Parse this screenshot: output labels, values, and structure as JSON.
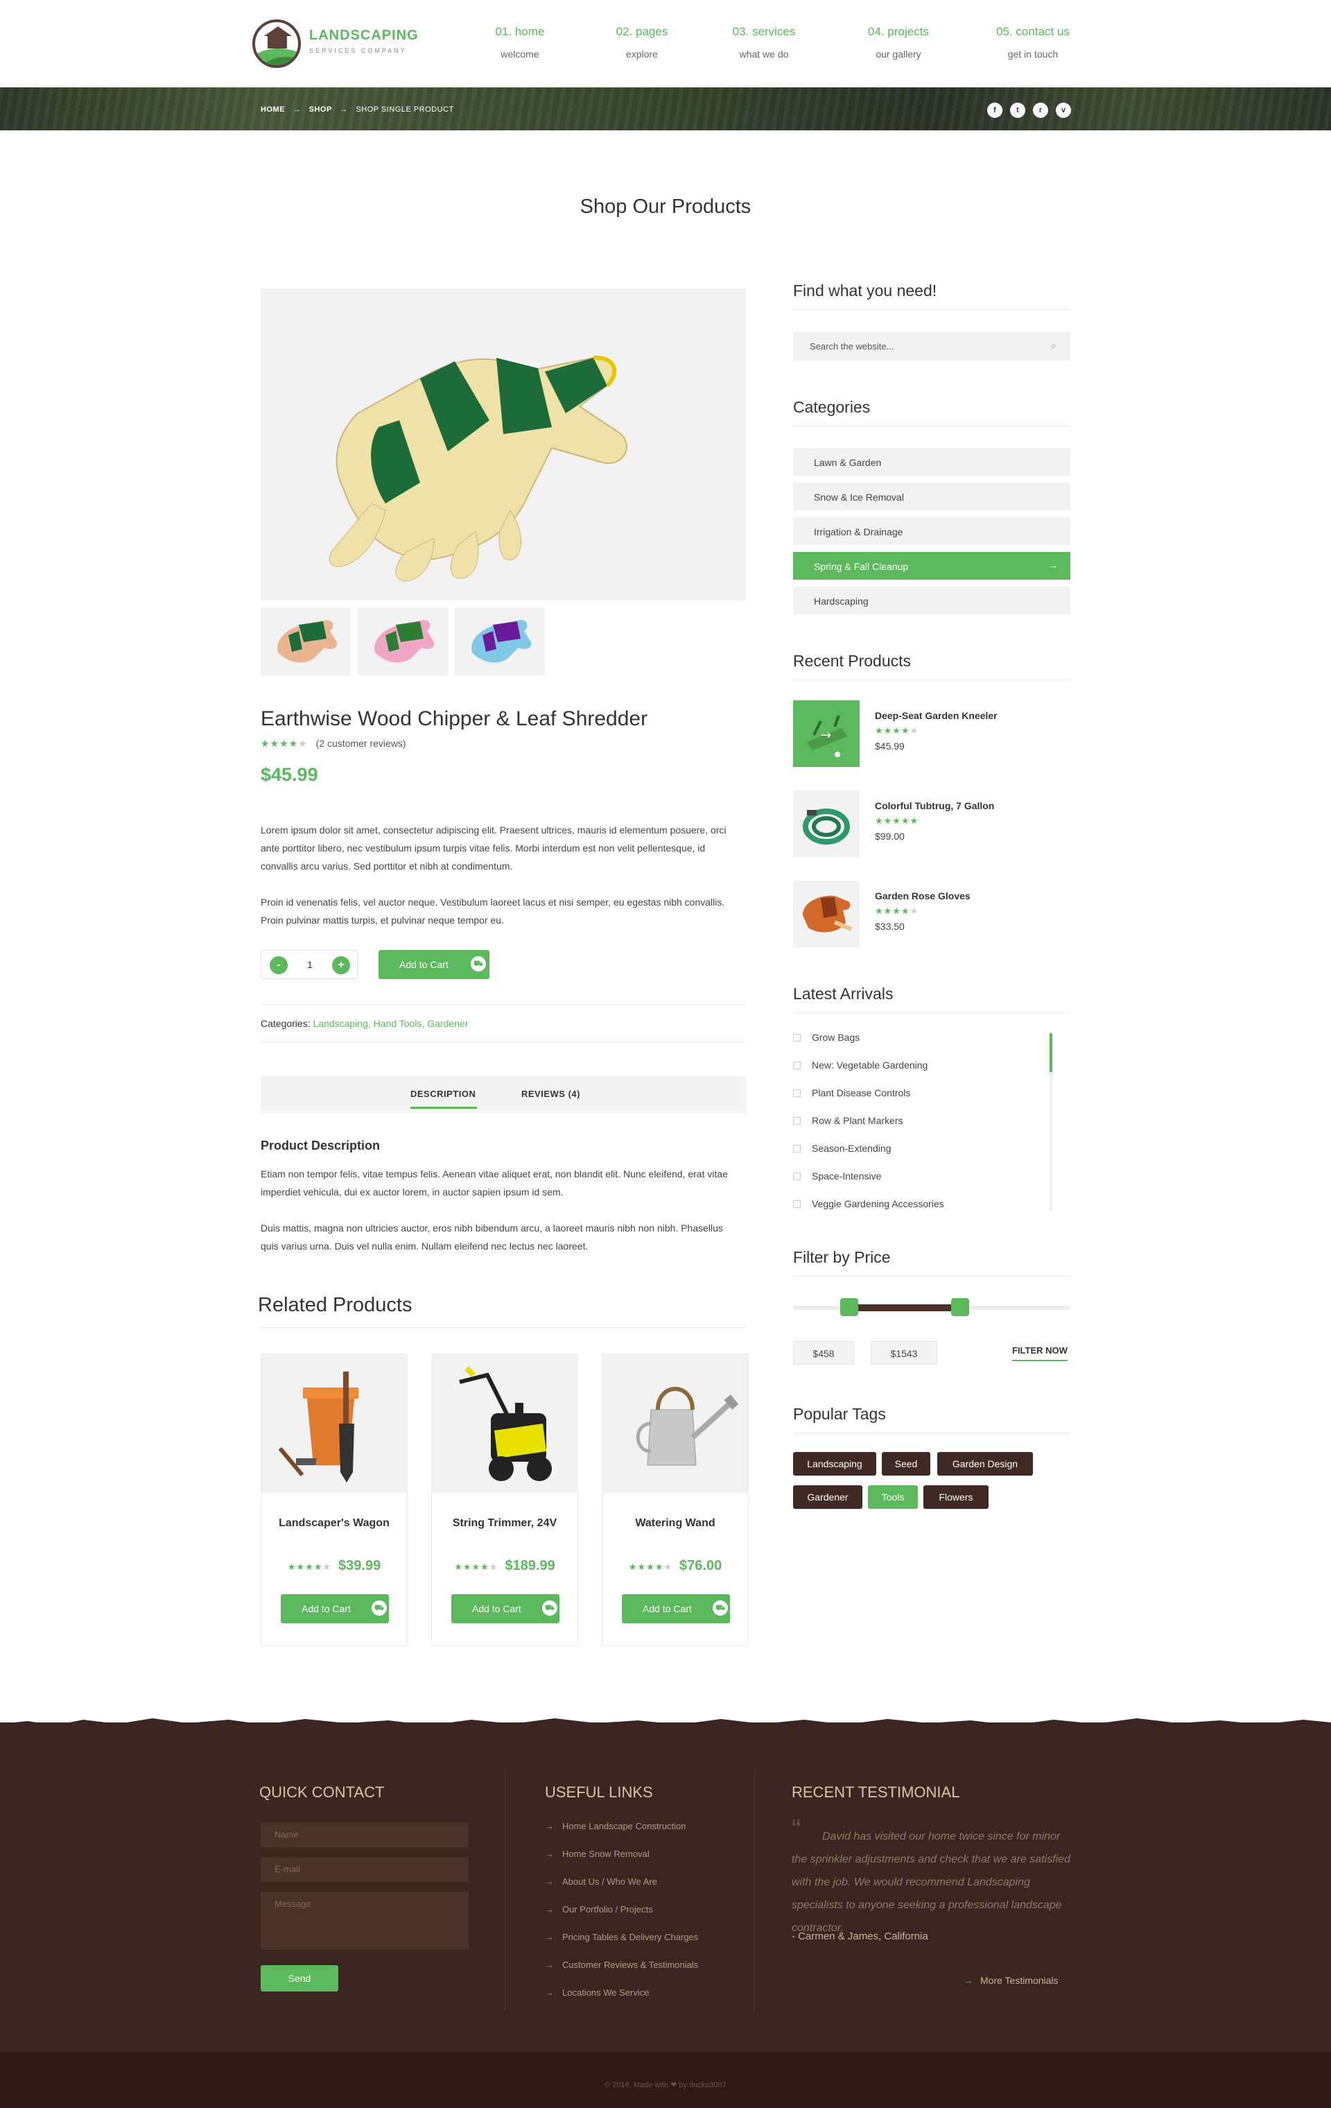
{
  "header": {
    "logo_title": "LANDSCAPING",
    "logo_subtitle": "SERVICES COMPANY",
    "nav": [
      {
        "title": "01. home",
        "sub": "welcome"
      },
      {
        "title": "02. pages",
        "sub": "explore"
      },
      {
        "title": "03. services",
        "sub": "what we do"
      },
      {
        "title": "04. projects",
        "sub": "our gallery"
      },
      {
        "title": "05. contact us",
        "sub": "get in touch"
      }
    ]
  },
  "breadcrumb": {
    "home": "HOME",
    "sep": "→",
    "shop": "SHOP",
    "current": "SHOP SINGLE PRODUCT"
  },
  "social": [
    {
      "icon": "facebook-icon",
      "glyph": "f"
    },
    {
      "icon": "twitter-icon",
      "glyph": "t"
    },
    {
      "icon": "rss-icon",
      "glyph": "r"
    },
    {
      "icon": "vimeo-icon",
      "glyph": "v"
    }
  ],
  "page_title": "Shop Our Products",
  "product": {
    "title": "Earthwise Wood Chipper & Leaf Shredder",
    "rating_stars": 4,
    "reviews": "(2 customer reviews)",
    "price": "$45.99",
    "desc1": "Lorem ipsum dolor sit amet, consectetur adipiscing elit. Praesent ultrices, mauris id elementum posuere, orci ante porttitor libero, nec vestibulum ipsum turpis vitae felis. Morbi interdum est non velit pellentesque, id convallis arcu varius. Sed porttitor et nibh at condimentum.",
    "desc2": "Proin id venenatis felis, vel auctor neque. Vestibulum laoreet lacus et nisi semper, eu egestas nibh convallis. Proin pulvinar mattis turpis, et pulvinar neque tempor eu.",
    "qty_minus": "-",
    "qty": "1",
    "qty_plus": "+",
    "add_to_cart": "Add to Cart",
    "categories_label": "Categories:",
    "categories": "Landscaping, Hand Tools, Gardener"
  },
  "tabs": {
    "description": "DESCRIPTION",
    "reviews": "REVIEWS (4)"
  },
  "description": {
    "heading": "Product Description",
    "p1": "Etiam non tempor felis, vitae tempus felis. Aenean vitae aliquet erat, non blandit elit. Nunc eleifend, erat vitae imperdiet vehicula, dui ex auctor lorem, in auctor sapien ipsum id sem.",
    "p2": "Duis mattis, magna non ultricies auctor, eros nibh bibendum arcu, a laoreet mauris nibh non nibh. Phasellus quis varius urna. Duis vel nulla enim. Nullam eleifend nec lectus nec laoreet."
  },
  "related": {
    "heading": "Related Products",
    "items": [
      {
        "name": "Landscaper's Wagon",
        "price": "$39.99",
        "stars": 4,
        "button": "Add to Cart"
      },
      {
        "name": "String Trimmer, 24V",
        "price": "$189.99",
        "stars": 4,
        "button": "Add to Cart"
      },
      {
        "name": "Watering Wand",
        "price": "$76.00",
        "stars": 4,
        "button": "Add to Cart"
      }
    ]
  },
  "sidebar": {
    "search_heading": "Find what you need!",
    "search_placeholder": "Search the website...",
    "categories_heading": "Categories",
    "categories": [
      "Lawn & Garden",
      "Snow & Ice Removal",
      "Irrigation & Drainage",
      "Spring & Fall Cleanup",
      "Hardscaping"
    ],
    "active_category": "Spring & Fall Cleanup",
    "recent_heading": "Recent Products",
    "recent": [
      {
        "name": "Deep-Seat Garden Kneeler",
        "stars": 4,
        "price": "$45.99"
      },
      {
        "name": "Colorful Tubtrug, 7 Gallon",
        "stars": 5,
        "price": "$99.00"
      },
      {
        "name": "Garden Rose Gloves",
        "stars": 4,
        "price": "$33.50"
      }
    ],
    "arrivals_heading": "Latest Arrivals",
    "arrivals": [
      "Grow Bags",
      "New: Vegetable Gardening",
      "Plant Disease Controls",
      "Row & Plant Markers",
      "Season-Extending",
      "Space-Intensive",
      "Veggie Gardening Accessories"
    ],
    "filter_heading": "Filter by Price",
    "price_min": "$458",
    "price_max": "$1543",
    "filter_button": "FILTER NOW",
    "tags_heading": "Popular Tags",
    "tags": [
      "Landscaping",
      "Seed",
      "Garden Design",
      "Gardener",
      "Tools",
      "Flowers"
    ],
    "active_tag": "Tools"
  },
  "footer": {
    "contact_heading": "QUICK CONTACT",
    "name_placeholder": "Name",
    "email_placeholder": "E-mail",
    "message_placeholder": "Message",
    "send": "Send",
    "links_heading": "USEFUL LINKS",
    "links": [
      "Home Landscape Construction",
      "Home Snow Removal",
      "About Us / Who We Are",
      "Our Portfolio / Projects",
      "Pricing Tables & Delivery Charges",
      "Customer Reviews & Testimonials",
      "Locations We Service"
    ],
    "testimonial_heading": "RECENT TESTIMONIAL",
    "testimonial": "David has visited our home twice since for minor the sprinkler adjustments and check that we are satisfied with the job. We would recommend Landscaping specialists to anyone seeking a professional landscape contractor.",
    "testimonial_author": "- Carmen & James, California",
    "more_testimonials": "More Testimonials",
    "copyright": "© 2016. Made with ❤ by ducka3007"
  },
  "colors": {
    "accent": "#5cb85c",
    "dark_brown": "#3b2520",
    "tag_brown": "#3e2a22"
  }
}
